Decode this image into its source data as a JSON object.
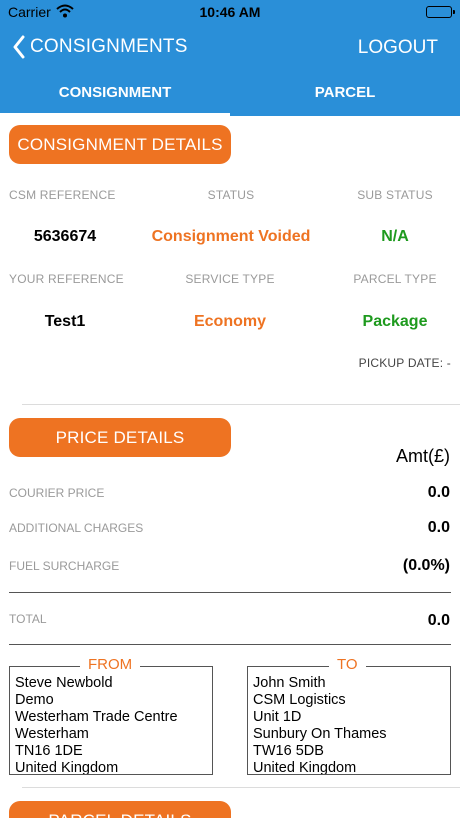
{
  "status_bar": {
    "carrier": "Carrier",
    "time": "10:46 AM"
  },
  "nav": {
    "back_label": "CONSIGNMENTS",
    "logout_label": "LOGOUT"
  },
  "tabs": [
    {
      "label": "CONSIGNMENT",
      "active": true
    },
    {
      "label": "PARCEL",
      "active": false
    }
  ],
  "consignment": {
    "header": "CONSIGNMENT DETAILS",
    "csm_reference_label": "CSM REFERENCE",
    "status_label": "STATUS",
    "sub_status_label": "SUB STATUS",
    "csm_reference": "5636674",
    "status": "Consignment Voided",
    "sub_status": "N/A",
    "your_reference_label": "YOUR REFERENCE",
    "service_type_label": "SERVICE TYPE",
    "parcel_type_label": "PARCEL TYPE",
    "your_reference": "Test1",
    "service_type": "Economy",
    "parcel_type": "Package",
    "pickup_date": "PICKUP DATE: -"
  },
  "price": {
    "header": "PRICE DETAILS",
    "amount_header": "Amt(£)",
    "rows": [
      {
        "label": "COURIER PRICE",
        "value": "0.0"
      },
      {
        "label": "ADDITIONAL CHARGES",
        "value": "0.0"
      },
      {
        "label": "FUEL SURCHARGE",
        "value": "(0.0%)"
      }
    ],
    "total_label": "TOTAL",
    "total_value": "0.0"
  },
  "from": {
    "legend": "FROM",
    "lines": [
      "Steve Newbold",
      "Demo",
      "Westerham Trade Centre",
      "Westerham",
      "TN16 1DE",
      "United Kingdom"
    ]
  },
  "to": {
    "legend": "TO",
    "lines": [
      "John Smith",
      "CSM Logistics",
      "Unit 1D",
      "Sunbury On Thames",
      "TW16 5DB",
      "United Kingdom"
    ]
  },
  "parcel": {
    "header": "PARCEL DETAILS"
  },
  "colors": {
    "nav_blue": "#2a8fd8",
    "accent_orange": "#ee7322",
    "status_green": "#1e9a1e"
  }
}
